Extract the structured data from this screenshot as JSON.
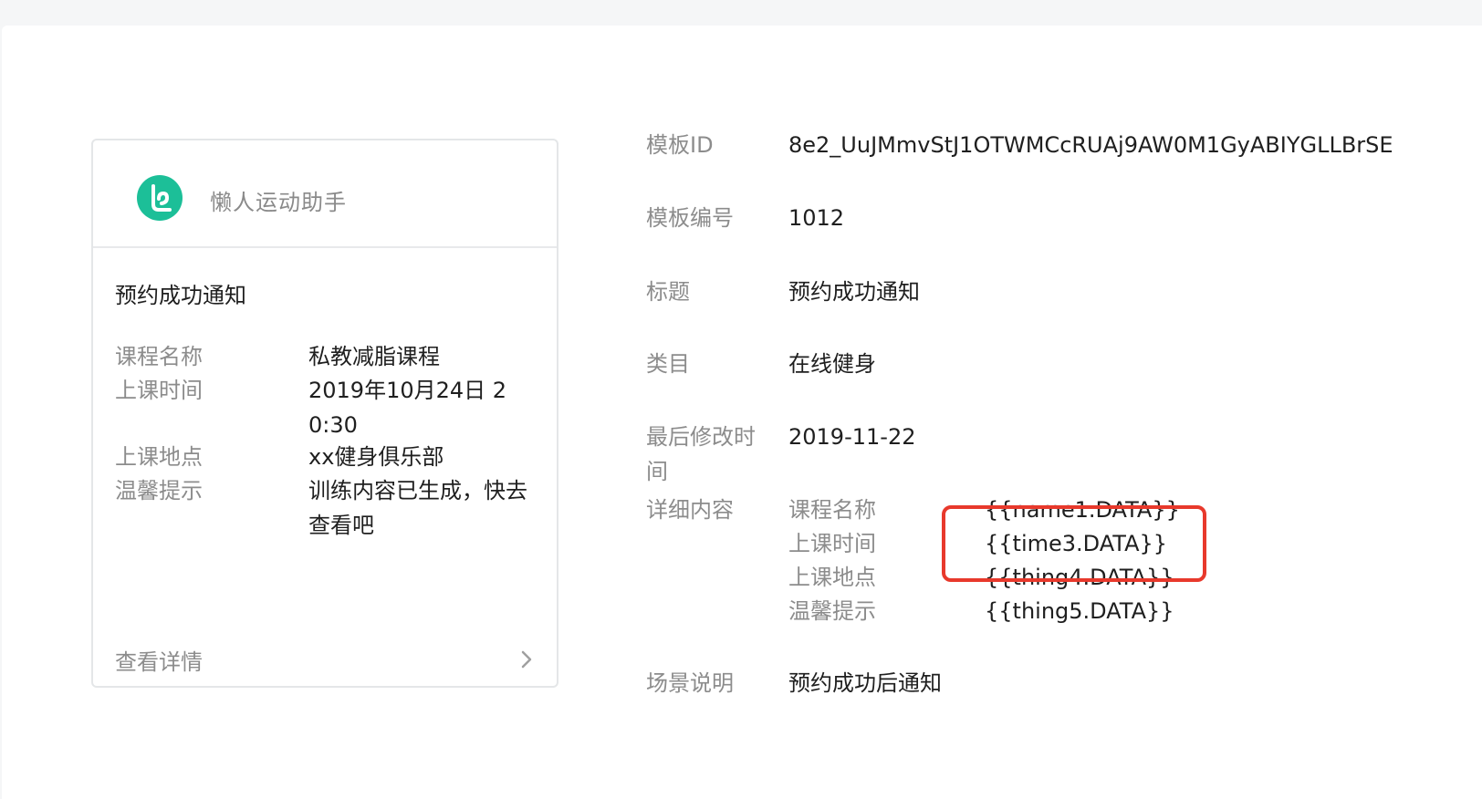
{
  "card": {
    "brand": "懒人运动助手",
    "title": "预约成功通知",
    "fields": [
      {
        "key": "课程名称",
        "value": "私教减脂课程"
      },
      {
        "key": "上课时间",
        "value": "2019年10月24日 20:30"
      },
      {
        "key": "上课地点",
        "value": "xx健身俱乐部"
      },
      {
        "key": "温馨提示",
        "value": "训练内容已生成，快去查看吧"
      }
    ],
    "footer": "查看详情"
  },
  "details": {
    "template_id_label": "模板ID",
    "template_id": "8e2_UuJMmvStJ1OTWMCcRUAj9AW0M1GyABIYGLLBrSE",
    "template_no_label": "模板编号",
    "template_no": "1012",
    "title_label": "标题",
    "title": "预约成功通知",
    "category_label": "类目",
    "category": "在线健身",
    "modified_label": "最后修改时间",
    "modified": "2019-11-22",
    "content_label": "详细内容",
    "content": [
      {
        "key": "课程名称",
        "value": "{{name1.DATA}}"
      },
      {
        "key": "上课时间",
        "value": "{{time3.DATA}}"
      },
      {
        "key": "上课地点",
        "value": "{{thing4.DATA}}"
      },
      {
        "key": "温馨提示",
        "value": "{{thing5.DATA}}"
      }
    ],
    "scene_label": "场景说明",
    "scene": "预约成功后通知"
  },
  "colors": {
    "accent": "#1cbf98",
    "highlight": "#e8392c"
  }
}
